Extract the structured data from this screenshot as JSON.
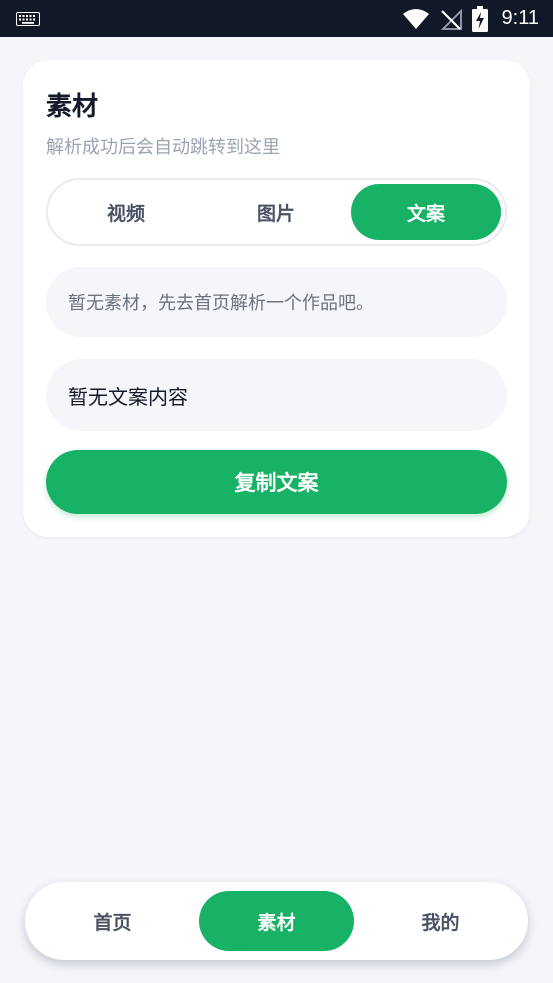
{
  "status_bar": {
    "time": "9:11",
    "icons": [
      "keyboard-icon",
      "wifi-icon",
      "no-signal-icon",
      "battery-charging-icon"
    ]
  },
  "card": {
    "title": "素材",
    "subtitle": "解析成功后会自动跳转到这里",
    "tabs": [
      {
        "label": "视频",
        "active": false
      },
      {
        "label": "图片",
        "active": false
      },
      {
        "label": "文案",
        "active": true
      }
    ],
    "notice": "暂无素材，先去首页解析一个作品吧。",
    "content_text": "暂无文案内容",
    "copy_button_label": "复制文案"
  },
  "bottom_nav": {
    "items": [
      {
        "label": "首页",
        "active": false
      },
      {
        "label": "素材",
        "active": true
      },
      {
        "label": "我的",
        "active": false
      }
    ]
  },
  "colors": {
    "accent": "#17b265",
    "background": "#f4f6fa",
    "status_bar": "#111827"
  }
}
